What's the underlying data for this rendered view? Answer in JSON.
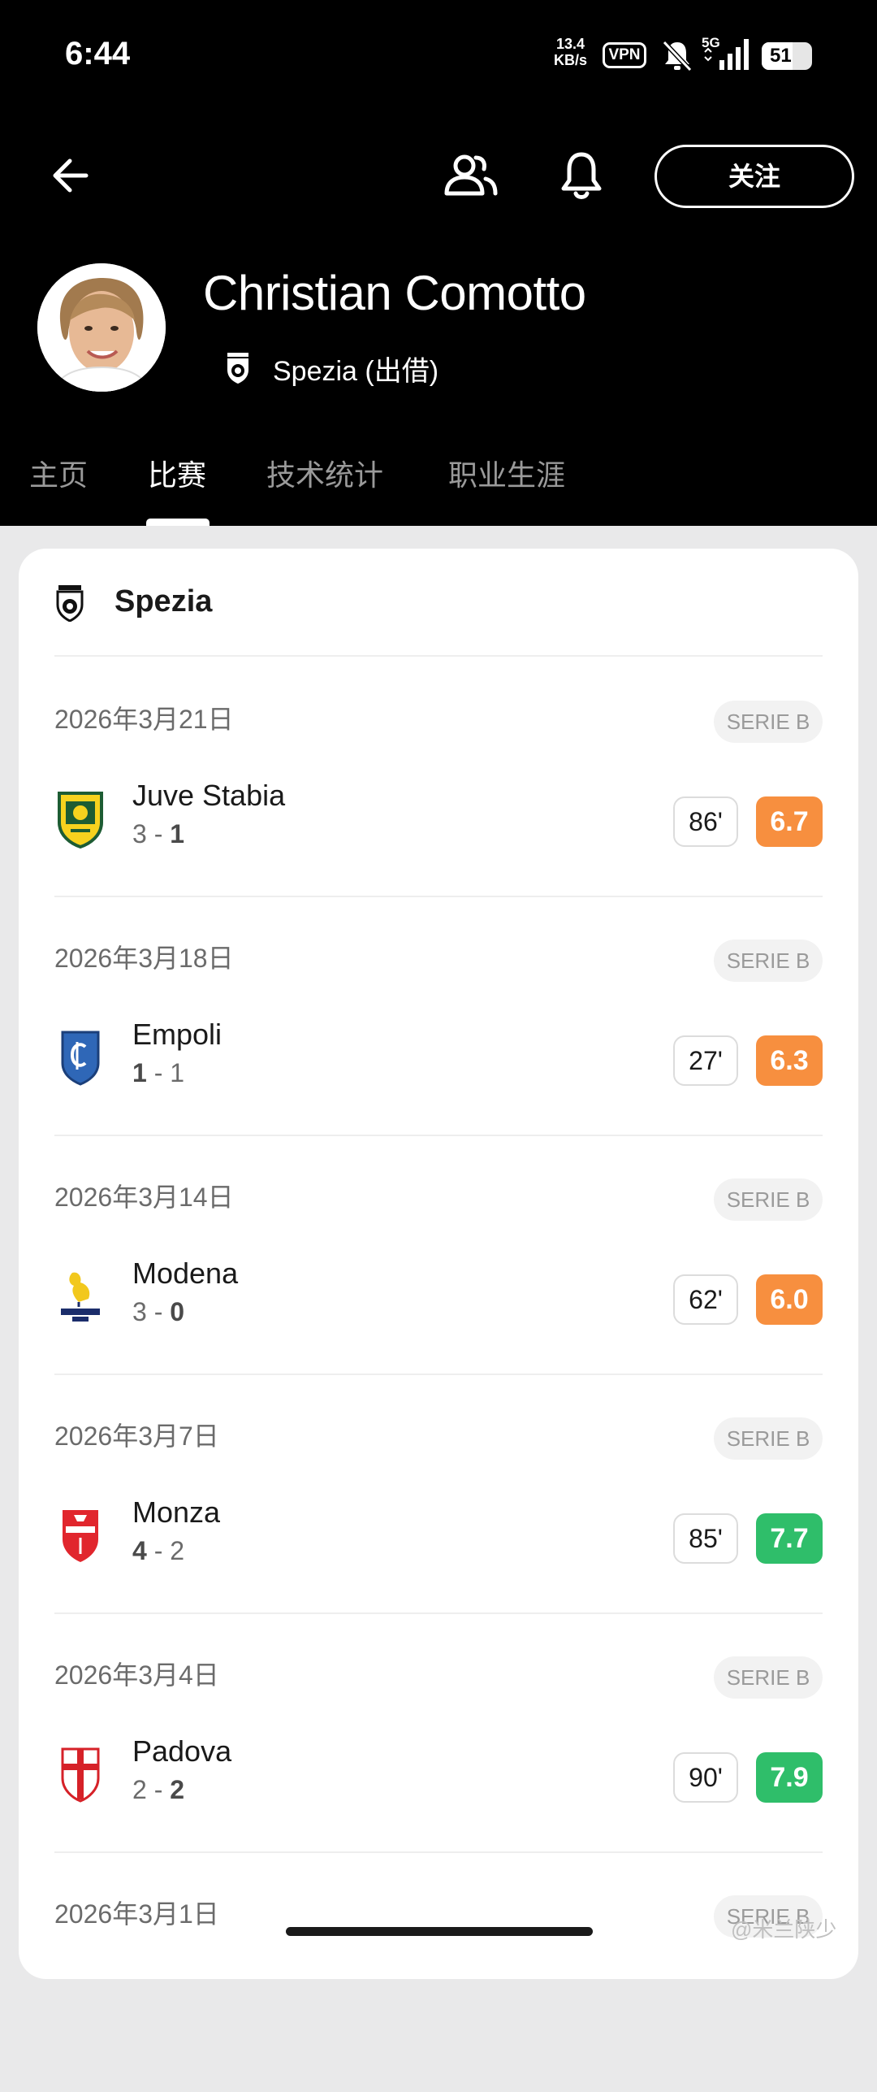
{
  "status_bar": {
    "time": "6:44",
    "net_speed_top": "13.4",
    "net_speed_bottom": "KB/s",
    "vpn": "VPN",
    "network": "5G",
    "battery": "51"
  },
  "header": {
    "follow_label": "关注",
    "player_name": "Christian Comotto",
    "team": "Spezia (出借)"
  },
  "tabs": [
    {
      "label": "主页",
      "active": false
    },
    {
      "label": "比赛",
      "active": true
    },
    {
      "label": "技术统计",
      "active": false
    },
    {
      "label": "职业生涯",
      "active": false
    }
  ],
  "card": {
    "title": "Spezia",
    "matches": [
      {
        "date": "2026年3月21日",
        "league": "SERIE B",
        "opponent": "Juve Stabia",
        "score_a": "3",
        "score_b": "1",
        "bold": "b",
        "minutes": "86'",
        "rating": "6.7",
        "rating_color": "#f78f3f",
        "crest": "juve-stabia-crest-icon"
      },
      {
        "date": "2026年3月18日",
        "league": "SERIE B",
        "opponent": "Empoli",
        "score_a": "1",
        "score_b": "1",
        "bold": "a",
        "minutes": "27'",
        "rating": "6.3",
        "rating_color": "#f78f3f",
        "crest": "empoli-crest-icon"
      },
      {
        "date": "2026年3月14日",
        "league": "SERIE B",
        "opponent": "Modena",
        "score_a": "3",
        "score_b": "0",
        "bold": "b",
        "minutes": "62'",
        "rating": "6.0",
        "rating_color": "#f78f3f",
        "crest": "modena-crest-icon"
      },
      {
        "date": "2026年3月7日",
        "league": "SERIE B",
        "opponent": "Monza",
        "score_a": "4",
        "score_b": "2",
        "bold": "a",
        "minutes": "85'",
        "rating": "7.7",
        "rating_color": "#2fbe6a",
        "crest": "monza-crest-icon"
      },
      {
        "date": "2026年3月4日",
        "league": "SERIE B",
        "opponent": "Padova",
        "score_a": "2",
        "score_b": "2",
        "bold": "b",
        "minutes": "90'",
        "rating": "7.9",
        "rating_color": "#2fbe6a",
        "crest": "padova-crest-icon"
      },
      {
        "date": "2026年3月1日",
        "league": "SERIE B"
      }
    ]
  },
  "watermark": "@米兰陕少"
}
